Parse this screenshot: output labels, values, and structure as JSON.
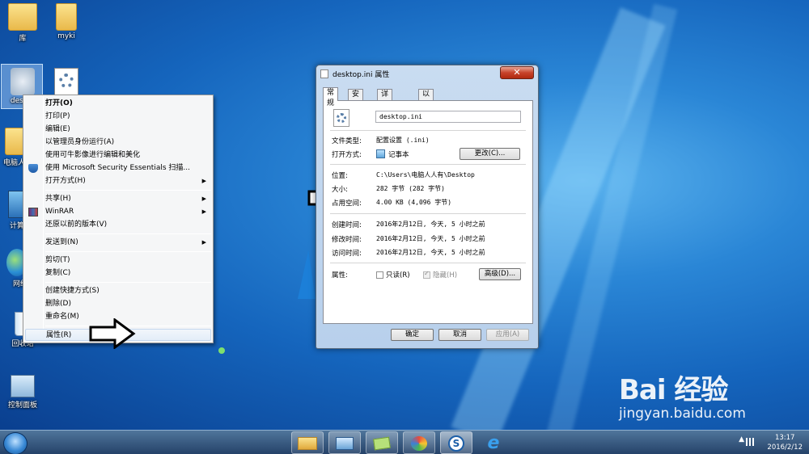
{
  "desktop": {
    "icons": [
      {
        "label": "库",
        "icon": "library-folder-icon"
      },
      {
        "label": "myki",
        "icon": "folder-icon"
      },
      {
        "label": "desktop.ini",
        "icon": "settings-file-icon"
      },
      {
        "label": "",
        "icon": "settings-file-icon"
      },
      {
        "label": "电脑人人",
        "icon": "user-folder-icon"
      },
      {
        "label": "计算",
        "icon": "computer-icon"
      },
      {
        "label": "网络",
        "icon": "network-icon"
      },
      {
        "label": "回收站",
        "icon": "recycle-bin-icon"
      },
      {
        "label": "控制面板",
        "icon": "control-panel-icon"
      }
    ],
    "selected_icon_label": "deskto"
  },
  "context_menu": {
    "items": [
      {
        "label": "打开(O)",
        "bold": true
      },
      {
        "label": "打印(P)"
      },
      {
        "label": "编辑(E)"
      },
      {
        "label": "以管理员身份运行(A)"
      },
      {
        "label": "使用可牛影像进行编辑和美化"
      },
      {
        "label": "使用 Microsoft Security Essentials 扫描...",
        "icon": "shield-icon"
      },
      {
        "label": "打开方式(H)",
        "submenu": true
      },
      {
        "label": "共享(H)",
        "submenu": true
      },
      {
        "label": "WinRAR",
        "submenu": true,
        "icon": "winrar-icon"
      },
      {
        "label": "还原以前的版本(V)"
      },
      {
        "label": "发送到(N)",
        "submenu": true
      },
      {
        "label": "剪切(T)"
      },
      {
        "label": "复制(C)"
      },
      {
        "label": "创建快捷方式(S)"
      },
      {
        "label": "删除(D)"
      },
      {
        "label": "重命名(M)"
      },
      {
        "label": "属性(R)",
        "highlighted": true
      }
    ]
  },
  "properties": {
    "title": "desktop.ini 属性",
    "close_label": "✕",
    "tabs": [
      "常规",
      "安全",
      "详细信息",
      "以前的版本"
    ],
    "active_tab": "常规",
    "file_name": "desktop.ini",
    "file_type_label": "文件类型:",
    "file_type_value": "配置设置 (.ini)",
    "open_with_label": "打开方式:",
    "open_with_value": "记事本",
    "change_button": "更改(C)...",
    "location_label": "位置:",
    "location_value": "C:\\Users\\电脑人人有\\Desktop",
    "size_label": "大小:",
    "size_value": "282 字节 (282 字节)",
    "disk_size_label": "占用空间:",
    "disk_size_value": "4.00 KB (4,096 字节)",
    "created_label": "创建时间:",
    "created_value": "2016年2月12日, 今天, 5 小时之前",
    "modified_label": "修改时间:",
    "modified_value": "2016年2月12日, 今天, 5 小时之前",
    "accessed_label": "访问时间:",
    "accessed_value": "2016年2月12日, 今天, 5 小时之前",
    "attributes_label": "属性:",
    "readonly_label": "只读(R)",
    "hidden_label": "隐藏(H)",
    "advanced_button": "高级(D)...",
    "ok_button": "确定",
    "cancel_button": "取消",
    "apply_button": "应用(A)"
  },
  "taskbar": {
    "time": "13:17",
    "date": "2016/2/12"
  },
  "watermark": {
    "main": "Bai 经验",
    "sub": "jingyan.baidu.com"
  }
}
